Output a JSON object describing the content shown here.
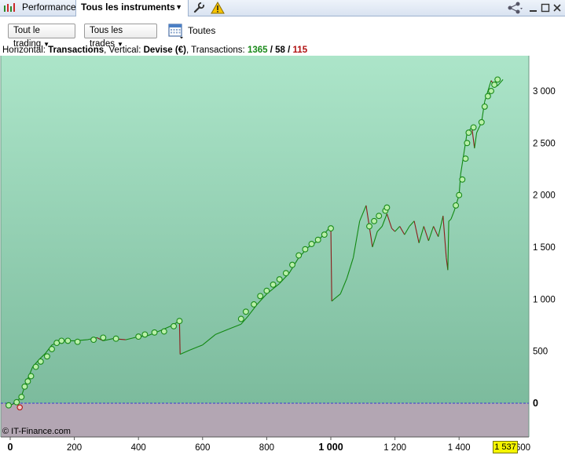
{
  "tabs": {
    "performance_label": "Performance",
    "instruments_label": "Tous les instruments"
  },
  "toolbar": {
    "trading_dropdown": "Tout le trading",
    "trades_dropdown": "Tous les trades",
    "period_label": "Toutes"
  },
  "info": {
    "horizontal_label": "Horizontal: ",
    "horizontal_value": "Transactions",
    "vertical_label": ", Vertical: ",
    "vertical_value": "Devise (€)",
    "transactions_label": ", Transactions: ",
    "total": "1365",
    "sep1": " / ",
    "neutral": "58",
    "sep2": " / ",
    "losing": "115"
  },
  "copyright": "© IT-Finance.com",
  "colors": {
    "plot_top": "#ace5c9",
    "plot_bottom": "#7cbb9d",
    "negative_zone": "#b3a6b3",
    "rise_line": "#118811",
    "fall_line": "#8b1a1a",
    "marker_fill": "#b8f0a8",
    "marker_stroke": "#1a8a1a",
    "cursor_badge": "#f5f500"
  },
  "icons": [
    "performance-chart-icon",
    "dropdown-caret-icon",
    "wrench-icon",
    "warning-icon",
    "share-icon",
    "minimize-icon",
    "maximize-icon",
    "close-icon",
    "calendar-icon"
  ],
  "chart_data": {
    "type": "line",
    "xlabel": "",
    "ylabel": "",
    "xlim": [
      0,
      1600
    ],
    "ylim": [
      -200,
      3300
    ],
    "x_ticks": [
      0,
      200,
      400,
      600,
      800,
      1000,
      1200,
      1400
    ],
    "x_tick_labels": [
      "0",
      "200",
      "400",
      "600",
      "800",
      "1 000",
      "1 200",
      "1 400"
    ],
    "x_tick_bold": [
      true,
      false,
      false,
      false,
      false,
      true,
      false,
      false
    ],
    "x_end_label": "600",
    "y_ticks": [
      0,
      500,
      1000,
      1500,
      2000,
      2500,
      3000
    ],
    "y_tick_labels": [
      "0",
      "500",
      "1 000",
      "1 500",
      "2 000",
      "2 500",
      "3 000"
    ],
    "y_tick_bold": [
      true,
      false,
      false,
      false,
      false,
      false,
      false
    ],
    "cursor_x": "1 537",
    "grid": false,
    "series": [
      {
        "x": [
          0,
          20,
          35,
          50,
          70,
          90,
          110,
          130,
          160,
          200,
          240,
          270,
          290,
          320,
          360,
          400,
          430,
          470,
          500,
          528,
          530,
          560,
          600,
          640,
          680,
          720,
          740,
          770,
          800,
          840,
          870,
          900,
          930,
          960,
          1000,
          1003,
          1010,
          1030,
          1050,
          1070,
          1090,
          1110,
          1130,
          1145,
          1160,
          1175,
          1190,
          1200,
          1215,
          1230,
          1245,
          1260,
          1275,
          1290,
          1305,
          1320,
          1335,
          1350,
          1360,
          1365,
          1368,
          1372,
          1375,
          1385,
          1400,
          1405,
          1415,
          1425,
          1440,
          1448,
          1455,
          1470,
          1480,
          1490,
          1500,
          1510,
          1520,
          1537
        ],
        "values": [
          -20,
          10,
          70,
          200,
          350,
          420,
          480,
          560,
          600,
          600,
          610,
          630,
          600,
          620,
          610,
          640,
          650,
          700,
          740,
          790,
          470,
          510,
          560,
          660,
          710,
          760,
          830,
          950,
          1050,
          1150,
          1250,
          1400,
          1500,
          1560,
          1700,
          980,
          1000,
          1050,
          1200,
          1400,
          1750,
          1900,
          1500,
          1650,
          1700,
          1820,
          1680,
          1650,
          1700,
          1620,
          1700,
          1750,
          1540,
          1700,
          1560,
          1700,
          1600,
          1800,
          1400,
          1280,
          1750,
          1760,
          1770,
          1850,
          2000,
          2200,
          2400,
          2600,
          2650,
          2450,
          2600,
          2700,
          2900,
          3000,
          3100,
          3050,
          3050,
          3110
        ],
        "points_x": [
          -5,
          20,
          35,
          45,
          55,
          65,
          80,
          95,
          115,
          130,
          145,
          160,
          180,
          210,
          260,
          290,
          330,
          400,
          420,
          450,
          480,
          510,
          528,
          720,
          735,
          760,
          780,
          800,
          820,
          840,
          860,
          880,
          900,
          920,
          940,
          960,
          980,
          1000,
          1120,
          1135,
          1150,
          1170,
          1175,
          1390,
          1400,
          1410,
          1420,
          1425,
          1430,
          1445,
          1470,
          1480,
          1490,
          1500,
          1510,
          1520
        ],
        "points_y": [
          -20,
          10,
          60,
          160,
          210,
          260,
          350,
          400,
          450,
          520,
          580,
          600,
          600,
          590,
          610,
          630,
          620,
          640,
          660,
          680,
          690,
          740,
          790,
          810,
          880,
          950,
          1030,
          1080,
          1140,
          1190,
          1250,
          1330,
          1420,
          1480,
          1530,
          1570,
          1620,
          1680,
          1700,
          1750,
          1800,
          1850,
          1880,
          1900,
          2000,
          2150,
          2350,
          2500,
          2600,
          2650,
          2700,
          2850,
          2950,
          3000,
          3060,
          3110
        ],
        "loss_points_x": [
          30
        ],
        "loss_points_y": [
          -40
        ]
      }
    ]
  }
}
